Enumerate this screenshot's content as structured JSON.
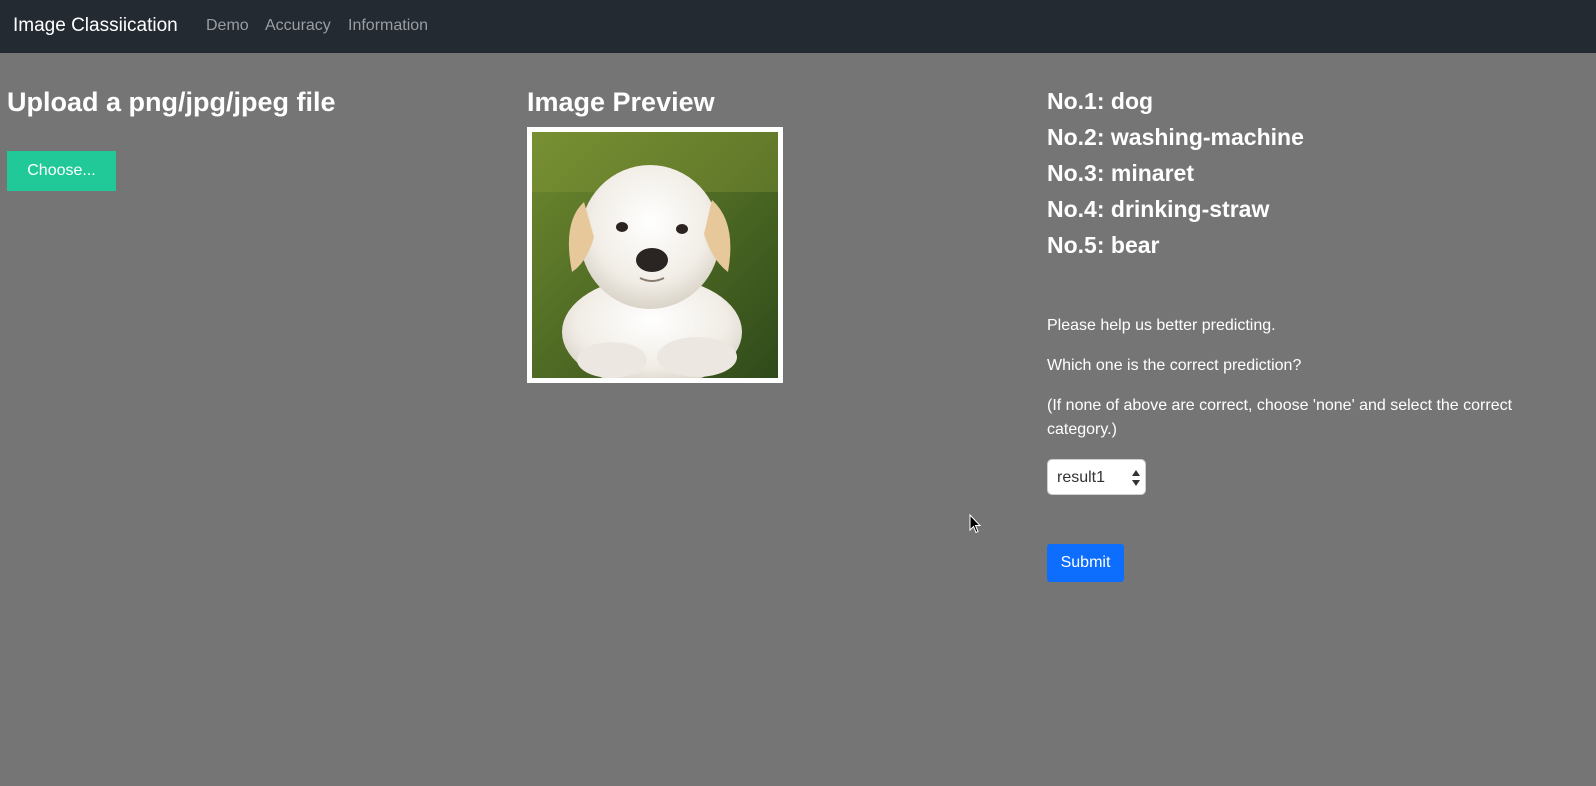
{
  "navbar": {
    "brand": "Image Classiication",
    "links": [
      "Demo",
      "Accuracy",
      "Information"
    ]
  },
  "upload": {
    "title": "Upload a png/jpg/jpeg file",
    "button_label": "Choose..."
  },
  "preview": {
    "title": "Image Preview",
    "image_subject": "puppy-photo"
  },
  "predictions": [
    "No.1: dog",
    "No.2: washing-machine",
    "No.3: minaret",
    "No.4: drinking-straw",
    "No.5: bear"
  ],
  "feedback": {
    "line1": "Please help us better predicting.",
    "line2": "Which one is the correct prediction?",
    "line3": "(If none of above are correct, choose 'none' and select the correct category.)",
    "select_value": "result1",
    "submit_label": "Submit"
  },
  "colors": {
    "navbar_bg": "#242a32",
    "page_bg": "#757575",
    "choose_button": "#20c997",
    "submit_button": "#0d6efd"
  }
}
